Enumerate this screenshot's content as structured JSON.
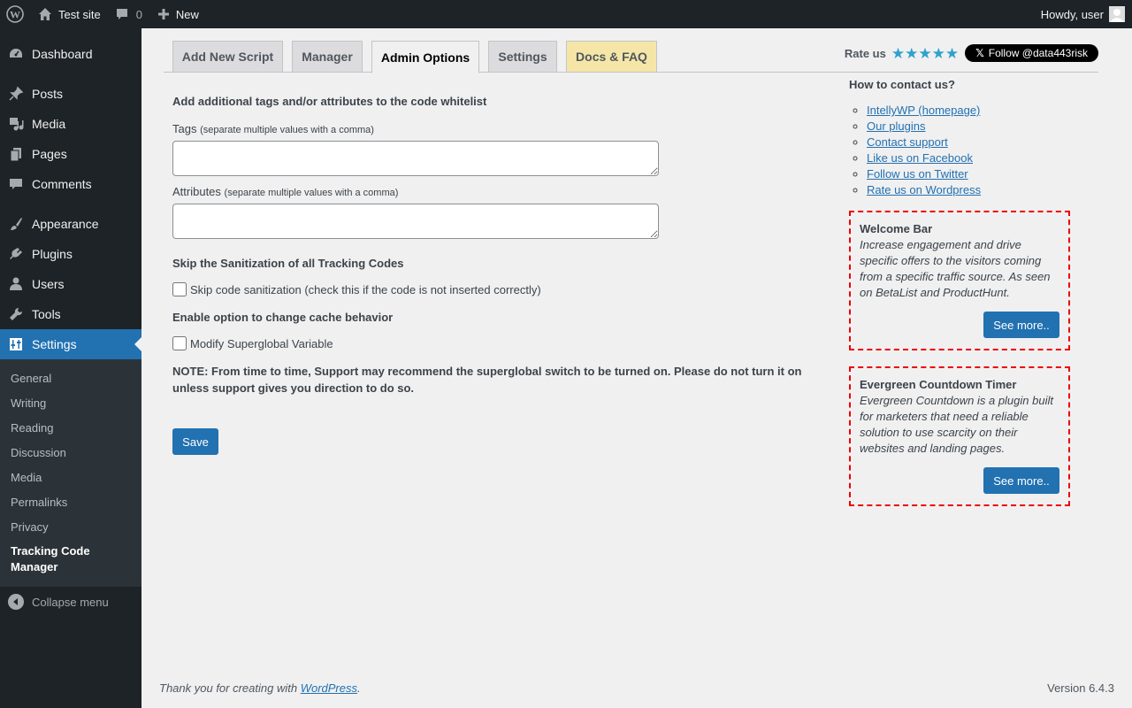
{
  "admin_bar": {
    "site_name": "Test site",
    "comments_count": "0",
    "new_label": "New",
    "greeting": "Howdy, user"
  },
  "sidebar": {
    "items": [
      {
        "label": "Dashboard",
        "icon": "dashboard-icon"
      },
      {
        "label": "Posts",
        "icon": "pin-icon"
      },
      {
        "label": "Media",
        "icon": "media-icon"
      },
      {
        "label": "Pages",
        "icon": "pages-icon"
      },
      {
        "label": "Comments",
        "icon": "comment-icon"
      },
      {
        "label": "Appearance",
        "icon": "brush-icon"
      },
      {
        "label": "Plugins",
        "icon": "plugin-icon"
      },
      {
        "label": "Users",
        "icon": "user-icon"
      },
      {
        "label": "Tools",
        "icon": "wrench-icon"
      },
      {
        "label": "Settings",
        "icon": "settings-icon"
      }
    ],
    "submenu": [
      "General",
      "Writing",
      "Reading",
      "Discussion",
      "Media",
      "Permalinks",
      "Privacy",
      "Tracking Code Manager"
    ],
    "collapse_label": "Collapse menu"
  },
  "tabs": [
    "Add New Script",
    "Manager",
    "Admin Options",
    "Settings",
    "Docs & FAQ"
  ],
  "active_tab": "Admin Options",
  "rate": {
    "label": "Rate us",
    "stars": 5,
    "follow_label": "Follow @data443risk"
  },
  "form": {
    "whitelist_title": "Add additional tags and/or attributes to the code whitelist",
    "tags_label": "Tags",
    "tags_hint": "(separate multiple values with a comma)",
    "tags_value": "",
    "attributes_label": "Attributes",
    "attributes_hint": "(separate multiple values with a comma)",
    "attributes_value": "",
    "sanitize_title": "Skip the Sanitization of all Tracking Codes",
    "sanitize_checkbox": "Skip code sanitization (check this if the code is not inserted correctly)",
    "cache_title": "Enable option to change cache behavior",
    "cache_checkbox": "Modify Superglobal Variable",
    "note": "NOTE: From time to time, Support may recommend the superglobal switch to be turned on. Please do not turn it on unless support gives you direction to do so.",
    "save_label": "Save"
  },
  "contact": {
    "title": "How to contact us?",
    "links": [
      "IntellyWP (homepage)",
      "Our plugins",
      "Contact support",
      "Like us on Facebook",
      "Follow us on Twitter",
      "Rate us on Wordpress"
    ]
  },
  "promos": [
    {
      "title": "Welcome Bar",
      "desc": "Increase engagement and drive specific offers to the visitors coming from a specific traffic source. As seen on BetaList and ProductHunt.",
      "button": "See more.."
    },
    {
      "title": "Evergreen Countdown Timer",
      "desc": "Evergreen Countdown is a plugin built for marketers that need a reliable solution to use scarcity on their websites and landing pages.",
      "button": "See more.."
    }
  ],
  "footer": {
    "thanks_prefix": "Thank you for creating with ",
    "thanks_link": "WordPress",
    "thanks_suffix": ".",
    "version": "Version 6.4.3"
  },
  "colors": {
    "admin_bg": "#1d2327",
    "accent": "#2271b1",
    "promo_border": "#e00000",
    "star": "#2ea2cc",
    "docs_tab": "#f5e6a8"
  }
}
